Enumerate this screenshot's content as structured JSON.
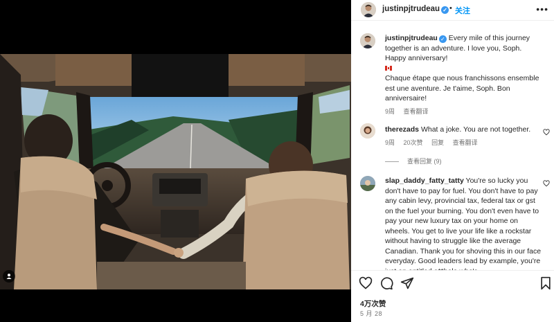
{
  "post": {
    "author": "justinpjtrudeau",
    "follow_label": "关注",
    "separator": "•",
    "caption_en": "Every mile of this journey together is an adventure. I love you, Soph. Happy anniversary!",
    "caption_fr": "Chaque étape que nous franchissons ensemble est une aventure. Je t'aime, Soph. Bon anniversaire!",
    "caption_flag": "canada-flag-icon",
    "caption_age": "9周",
    "see_translation": "查看翻译",
    "likes": "4万次赞",
    "date": "5 月 28"
  },
  "comments": [
    {
      "username": "therezads",
      "text": "What a joke. You are not together.",
      "age": "9周",
      "likes": "20次赞",
      "reply": "回复",
      "see_translation": "查看翻译",
      "view_replies": "查看回复 (9)"
    },
    {
      "username": "slap_daddy_fatty_tatty",
      "text": "You're so lucky you don't have to pay for fuel. You don't have to pay any cabin levy, provincial tax, federal tax or gst on the fuel your burning. You don't even have to pay your new luxury tax on your home on wheels. You get to live your life like a rockstar without having to struggle like the average Canadian. Thank you for shoving this in our face everyday. Good leaders lead by example, you're just an entitled a**hole who's"
    }
  ],
  "icons": {
    "more": "more-options-icon",
    "verified": "verified-badge-icon",
    "heart": "heart-icon",
    "comment": "comment-icon",
    "share": "share-icon",
    "save": "bookmark-icon",
    "tag": "user-tag-icon"
  },
  "colors": {
    "link_blue": "#0095f6",
    "verified_blue": "#3897f0",
    "muted_text": "#737373"
  }
}
